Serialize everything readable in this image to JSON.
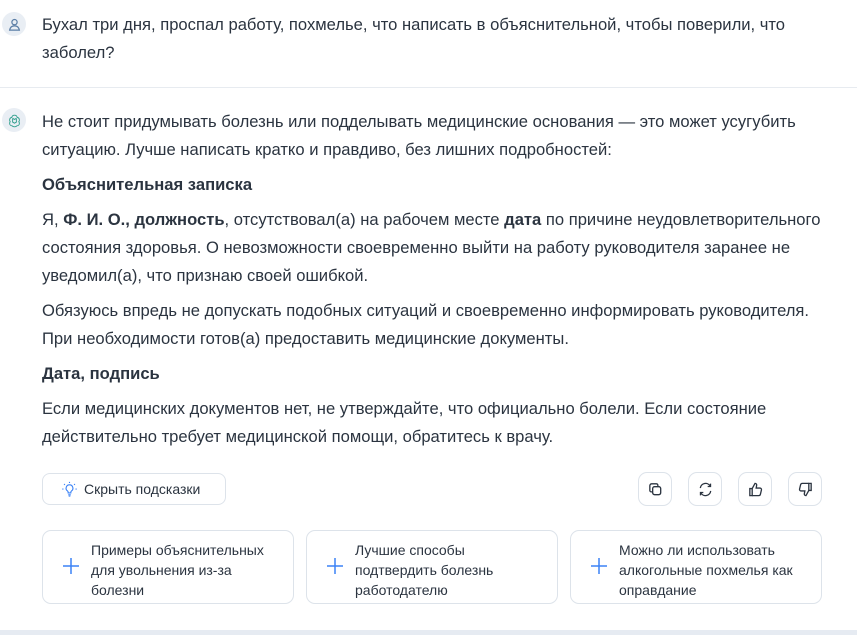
{
  "user_message": {
    "text": "Бухал три дня, проспал работу, похмелье, что написать в объяснительной, чтобы поверили, что заболел?"
  },
  "assistant_message": {
    "intro": "Не стоит придумывать болезнь или подделывать медицинские основания — это может усугубить ситуацию. Лучше написать кратко и правдиво, без лишних подробностей:",
    "heading": "Объяснительная записка",
    "p1": {
      "t1": "Я, ",
      "b1": "Ф. И. О., должность",
      "t2": ", отсутствовал(а) на рабочем месте ",
      "b2": "дата",
      "t3": " по причине неудовлетворительного состояния здоровья. О невозможности своевременно выйти на работу руководителя заранее не уведомил(а), что признаю своей ошибкой."
    },
    "p2": "Обязуюсь впредь не допускать подобных ситуаций и своевременно информировать руководителя. При необходимости готов(а) предоставить медицинские документы.",
    "signature": "Дата, подпись",
    "p3": "Если медицинских документов нет, не утверждайте, что официально болели. Если состояние действительно требует медицинской помощи, обратитесь к врачу."
  },
  "toolbar": {
    "hide_hints_label": "Скрыть подсказки",
    "hint_icon": "lightbulb-icon",
    "actions": [
      "copy-icon",
      "regenerate-icon",
      "thumbs-up-icon",
      "thumbs-down-icon"
    ]
  },
  "suggestions": [
    "Примеры объяснительных для увольнения из-за болезни",
    "Лучшие способы подтвердить болезнь работодателю",
    "Можно ли использовать алкогольные похмелья как оправдание"
  ],
  "colors": {
    "text": "#2b3440",
    "border": "#dde3ea",
    "accent": "#3b82f6",
    "avatar_bg": "#e9eef4"
  }
}
